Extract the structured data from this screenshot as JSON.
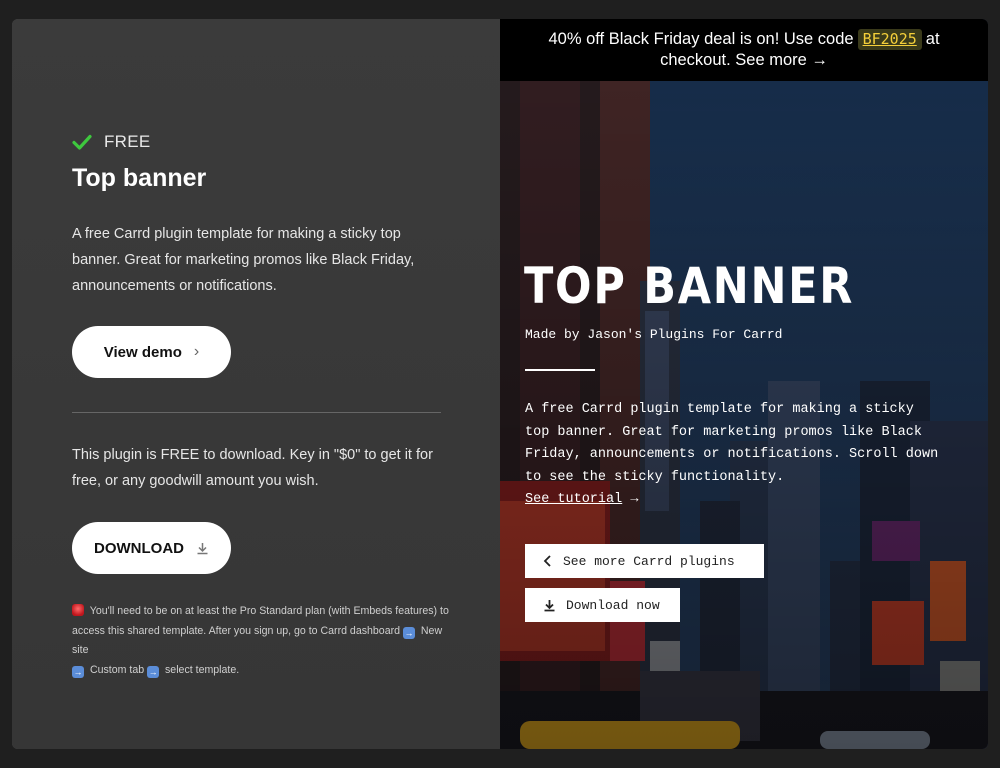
{
  "left": {
    "badge": "FREE",
    "title": "Top banner",
    "description": "A free Carrd plugin template for making a sticky top banner. Great for marketing promos like Black Friday, announcements or notifications.",
    "view_demo": "View demo",
    "plugin_text": "This plugin is FREE to download. Key in \"$0\" to get it for free, or any goodwill amount you wish.",
    "download": "DOWNLOAD",
    "note_part1": " You'll need to be on at least the Pro Standard plan (with Embeds features) to access this shared template. After you sign up, go to Carrd dashboard ",
    "note_part2": " New site ",
    "note_part3": " Custom tab ",
    "note_part4": " select template."
  },
  "right": {
    "banner_text": "40% off Black Friday deal is on! Use code",
    "banner_code": "BF2025",
    "banner_after": "at",
    "banner_line2": "checkout. See more →",
    "hero_title": "TOP BANNER",
    "byline": "Made by Jason's Plugins For Carrd",
    "hero_desc": "A free Carrd plugin template for making a sticky top banner. Great for marketing promos like Black Friday, announcements or notifications. Scroll down to see the sticky functionality.",
    "tutorial": "See tutorial",
    "tutorial_arrow": " →",
    "see_more": "See more Carrd plugins",
    "download_now": "Download now"
  },
  "colors": {
    "check": "#3ec83e",
    "code_text": "#f4cf3a"
  }
}
